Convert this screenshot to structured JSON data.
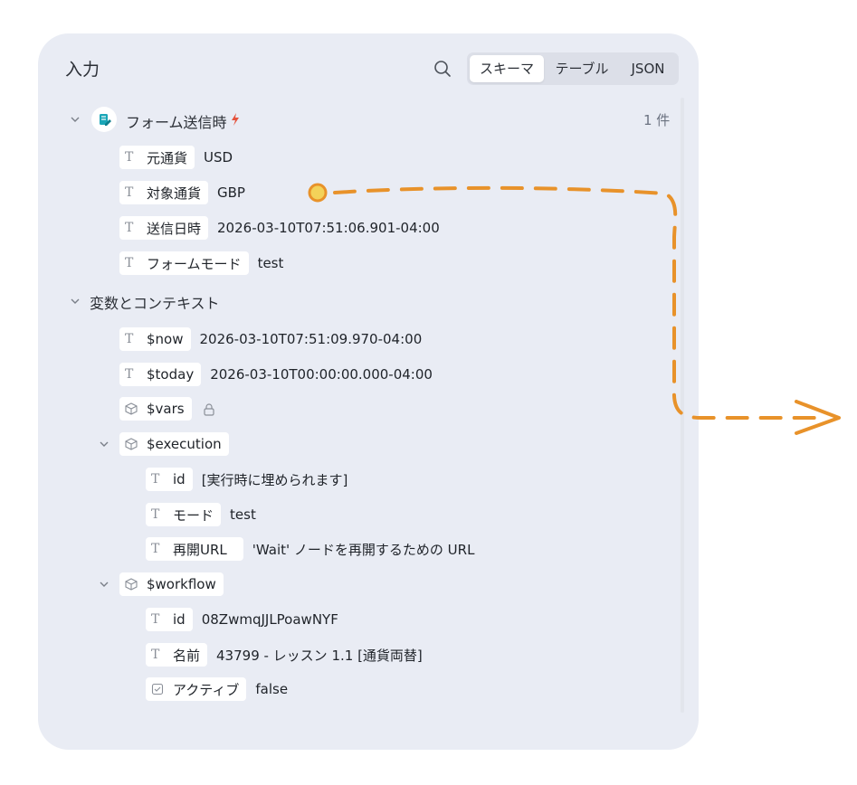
{
  "panel": {
    "title": "入力",
    "tabs": [
      {
        "label": "スキーマ",
        "active": true
      },
      {
        "label": "テーブル",
        "active": false
      },
      {
        "label": "JSON",
        "active": false
      }
    ]
  },
  "form_group": {
    "label": "フォーム送信時",
    "count": "1 件",
    "fields": [
      {
        "key": "元通貨",
        "value": "USD",
        "type": "text"
      },
      {
        "key": "対象通貨",
        "value": "GBP",
        "type": "text"
      },
      {
        "key": "送信日時",
        "value": "2026-03-10T07:51:06.901-04:00",
        "type": "text"
      },
      {
        "key": "フォームモード",
        "value": "test",
        "type": "text"
      }
    ]
  },
  "vars_group": {
    "label": "変数とコンテキスト",
    "now": {
      "key": "$now",
      "value": "2026-03-10T07:51:09.970-04:00"
    },
    "today": {
      "key": "$today",
      "value": "2026-03-10T00:00:00.000-04:00"
    },
    "vars": {
      "key": "$vars"
    },
    "execution": {
      "key": "$execution",
      "fields": [
        {
          "key": "id",
          "value": "[実行時に埋められます]"
        },
        {
          "key": "モード",
          "value": "test"
        },
        {
          "key": "再開URL",
          "value": "'Wait' ノードを再開するための URL"
        }
      ]
    },
    "workflow": {
      "key": "$workflow",
      "fields": [
        {
          "key": "id",
          "value": "08ZwmqJJLPoawNYF"
        },
        {
          "key": "名前",
          "value": "43799 - レッスン 1.1 [通貨両替]"
        },
        {
          "key": "アクティブ",
          "value": "false"
        }
      ]
    }
  },
  "colors": {
    "panel_bg": "#e9ecf4",
    "accent_orange": "#e8922a",
    "bolt_red": "#e5533d",
    "form_icon_teal": "#1aa6b7"
  }
}
